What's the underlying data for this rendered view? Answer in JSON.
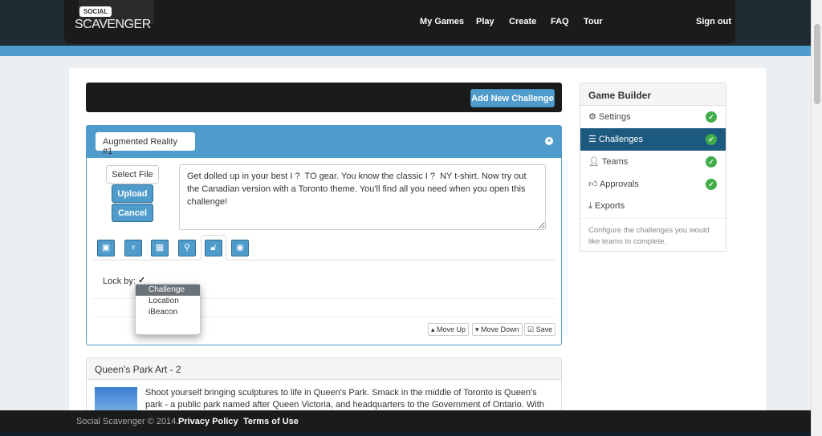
{
  "header": {
    "logo_badge": "SOCIAL",
    "logo_name": "SCAVENGER",
    "nav": [
      "My Games",
      "Play",
      "Create",
      "FAQ",
      "Tour"
    ],
    "sign_out": "Sign out"
  },
  "toolbar": {
    "add_challenge": "Add New Challenge"
  },
  "challenge": {
    "title": "Augmented Reality #1",
    "select_file": "Select File",
    "upload": "Upload",
    "cancel": "Cancel",
    "description": "Get dolled up in your best I ?  TO gear. You know the classic I ?  NY t-shirt. Now try out the Canadian version with a Toronto theme. You'll find all you need when you open this challenge!",
    "tabs": [
      "image-icon",
      "trophy-icon",
      "calendar-icon",
      "map-marker-icon",
      "unlock-icon",
      "eye-icon"
    ],
    "lock_label": "Lock by:",
    "lock_options": [
      "Challenge",
      "Location",
      "iBeacon"
    ],
    "lock_selected": "Challenge",
    "check_mark": "✓",
    "move_up": "Move Up",
    "move_down": "Move Down",
    "save": "Save"
  },
  "challenge2": {
    "title": "Queen's Park Art - 2",
    "description": "Shoot yourself bringing sculptures to life in Queen's Park. Smack in the middle of Toronto is Queen's park - a public park named after Queen Victoria, and headquarters to the Government of Ontario. With this much"
  },
  "sidebar": {
    "title": "Game Builder",
    "items": [
      {
        "label": "Settings",
        "done": true
      },
      {
        "label": "Challenges",
        "done": true,
        "active": true
      },
      {
        "label": "Teams",
        "done": true
      },
      {
        "label": "Approvals",
        "done": true
      },
      {
        "label": "Exports",
        "done": false
      }
    ],
    "help": "Configure the challenges you would like teams to complete."
  },
  "footer": {
    "copyright": "Social Scavenger © 2014.",
    "privacy": "Privacy Policy",
    "terms": "Terms of Use"
  },
  "colors": {
    "accent": "#4f9ccc",
    "active": "#1d5a80",
    "success": "#3fae49"
  }
}
